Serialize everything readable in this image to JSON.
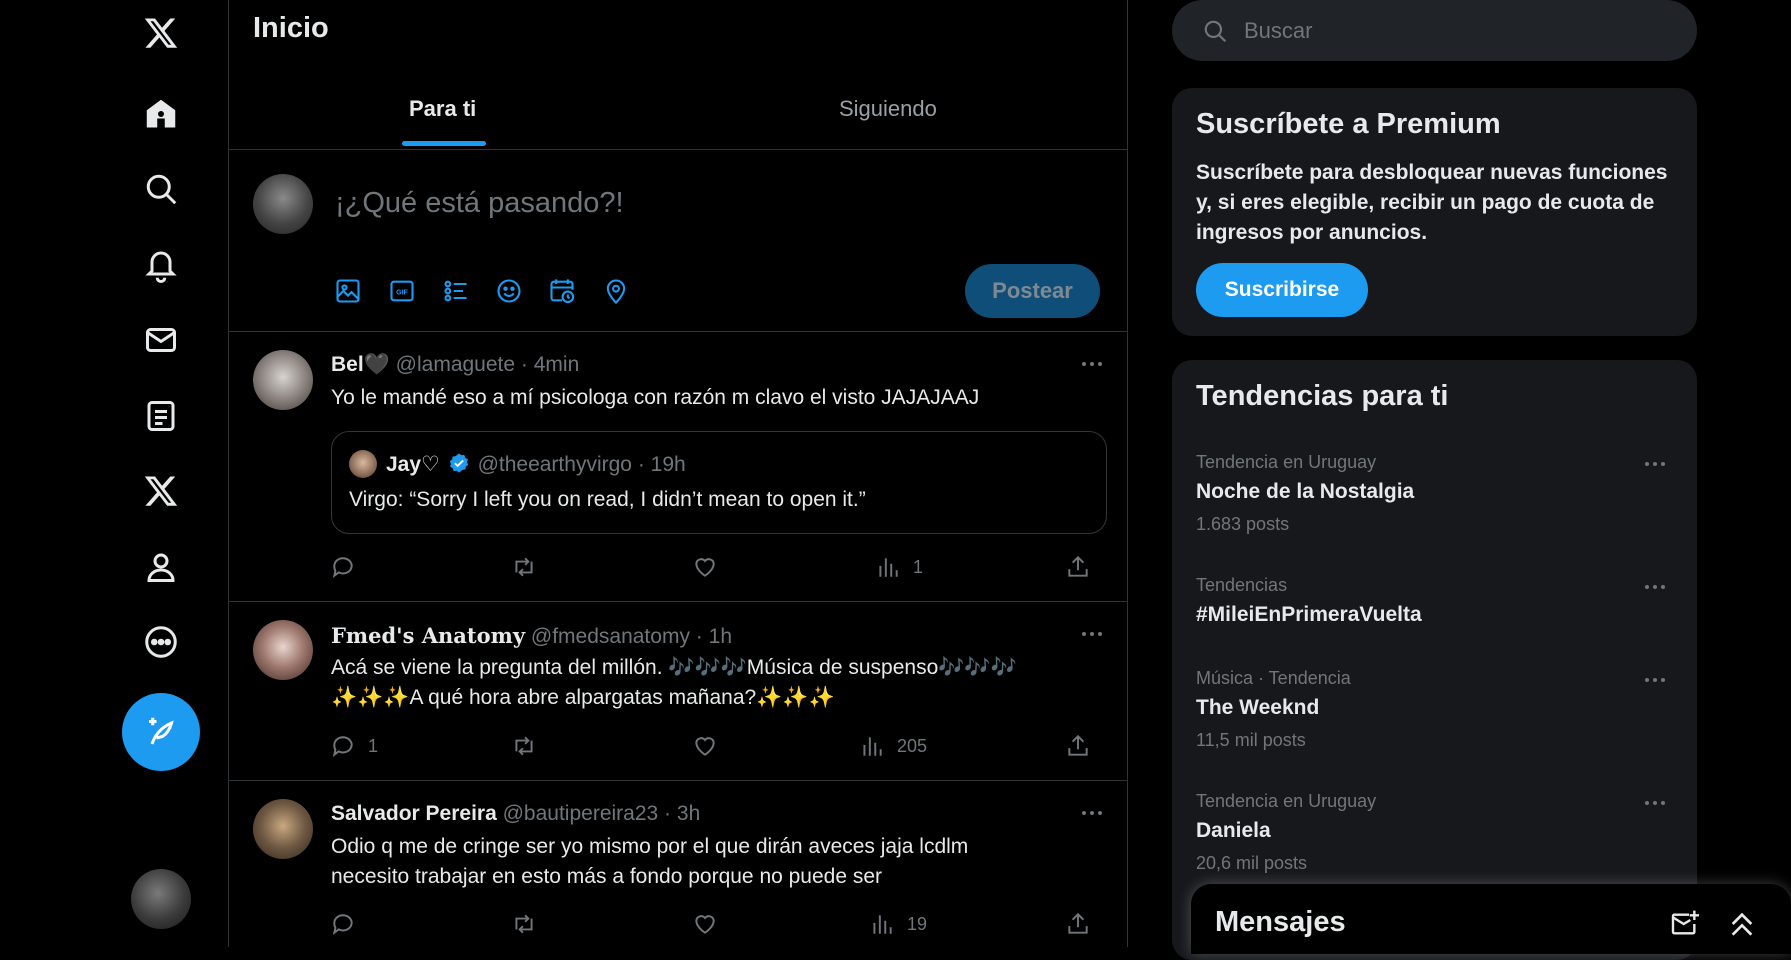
{
  "colors": {
    "accent": "#1d9bf0",
    "background": "#000000",
    "muted": "#71767b",
    "panel": "#16181c",
    "border": "#2f3336"
  },
  "nav": {
    "items": [
      "x-logo-icon",
      "home-icon",
      "search-icon",
      "notifications-icon",
      "messages-icon",
      "lists-icon",
      "premium-icon",
      "profile-icon",
      "more-icon"
    ]
  },
  "header": {
    "title": "Inicio"
  },
  "tabs": [
    {
      "label": "Para ti"
    },
    {
      "label": "Siguiendo"
    }
  ],
  "composer": {
    "placeholder": "¡¿Qué está pasando?!",
    "post_label": "Postear",
    "tools": [
      "image-icon",
      "gif-icon",
      "poll-icon",
      "emoji-icon",
      "schedule-icon",
      "location-icon"
    ]
  },
  "tweets": [
    {
      "name": "Bel🖤",
      "handle": "@lamaguete",
      "dot": "·",
      "time": "4min",
      "text": "Yo le mandé eso a mí psicologa con razón m clavo el visto JAJAJAAJ",
      "quote": {
        "name": "Jay♡",
        "handle": "@theearthyvirgo",
        "dot": "·",
        "time": "19h",
        "text": "Virgo: “Sorry I left you on read, I didn’t mean to open it.”"
      },
      "replies": "",
      "retweets": "",
      "likes": "",
      "views": "1"
    },
    {
      "name": "Fmed's Anatomy",
      "handle": "@fmedsanatomy",
      "dot": "·",
      "time": "1h",
      "text": "Acá se viene la pregunta del millón. 🎶🎶🎶Música de suspenso🎶🎶🎶 ✨✨✨A qué hora abre alpargatas mañana?✨✨✨",
      "replies": "1",
      "retweets": "",
      "likes": "",
      "views": "205"
    },
    {
      "name": "Salvador Pereira",
      "handle": "@bautipereira23",
      "dot": "·",
      "time": "3h",
      "text": "Odio q me de cringe ser yo mismo por el que dirán aveces jaja lcdlm necesito trabajar en esto más a fondo porque no puede ser",
      "replies": "",
      "retweets": "",
      "likes": "",
      "views": "19"
    }
  ],
  "search": {
    "placeholder": "Buscar"
  },
  "premium": {
    "title": "Suscríbete a Premium",
    "text": "Suscríbete para desbloquear nuevas funciones y, si eres elegible, recibir un pago de cuota de ingresos por anuncios.",
    "button": "Suscribirse"
  },
  "trends": {
    "title": "Tendencias para ti",
    "items": [
      {
        "context": "Tendencia en Uruguay",
        "name": "Noche de la Nostalgia",
        "count": "1.683 posts"
      },
      {
        "context": "Tendencias",
        "name": "#MileiEnPrimeraVuelta",
        "count": ""
      },
      {
        "context": "Música · Tendencia",
        "name": "The Weeknd",
        "count": "11,5 mil posts"
      },
      {
        "context": "Tendencia en Uruguay",
        "name": "Daniela",
        "count": "20,6 mil posts"
      }
    ]
  },
  "messages": {
    "title": "Mensajes"
  }
}
